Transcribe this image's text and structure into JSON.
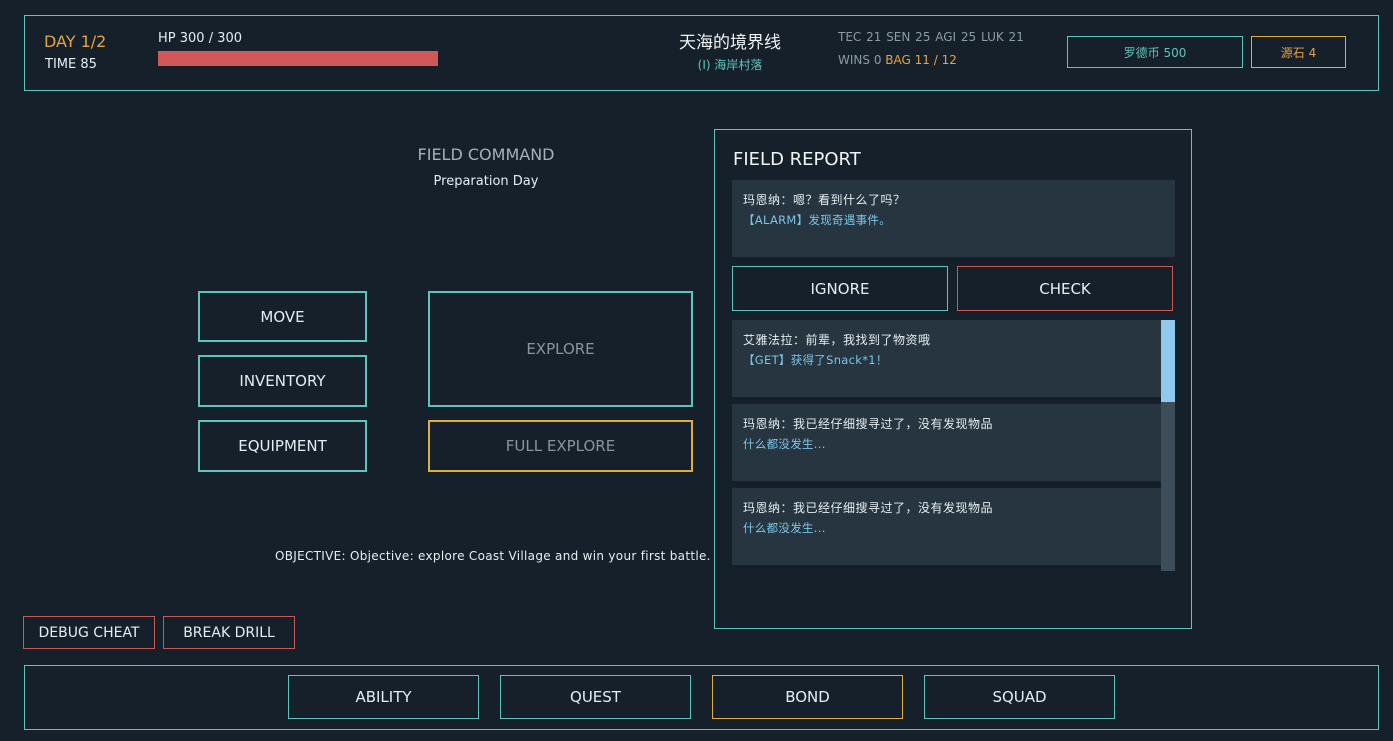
{
  "top_bar": {
    "day": "DAY 1/2",
    "time": "TIME  85",
    "hp_label": "HP  300 / 300",
    "hp_fraction": 1.0,
    "location_title": "天海的境界线",
    "location_sub": "(I)  海岸村落",
    "stats": "TEC 21  SEN 25  AGI 25  LUK 21",
    "wins": "WINS 0",
    "bag": "BAG 11 / 12",
    "coin": "罗德币  500",
    "stone": "源石  4"
  },
  "field_command": {
    "title": "FIELD COMMAND",
    "subtitle": "Preparation Day",
    "move": "MOVE",
    "inventory": "INVENTORY",
    "equipment": "EQUIPMENT",
    "explore": "EXPLORE",
    "full_explore": "FULL EXPLORE",
    "objective": "OBJECTIVE: Objective: explore Coast Village and win your first battle."
  },
  "debug": {
    "cheat": "DEBUG CHEAT",
    "break_drill": "BREAK DRILL"
  },
  "field_report": {
    "title": "FIELD REPORT",
    "alert": {
      "line1": "玛恩纳：嗯？看到什么了吗？",
      "line2": "【ALARM】发现奇遇事件。"
    },
    "ignore": "IGNORE",
    "check": "CHECK",
    "log": [
      {
        "line1": "艾雅法拉：前辈，我找到了物资哦",
        "line2": "【GET】获得了Snack*1！"
      },
      {
        "line1": "玛恩纳：我已经仔细搜寻过了，没有发现物品",
        "line2": "什么都没发生..."
      },
      {
        "line1": "玛恩纳：我已经仔细搜寻过了，没有发现物品",
        "line2": "什么都没发生..."
      }
    ]
  },
  "bottom_tabs": {
    "ability": "ABILITY",
    "quest": "QUEST",
    "bond": "BOND",
    "squad": "SQUAD"
  },
  "colors": {
    "teal": "#5fc4bb",
    "gold": "#e0ad43",
    "red": "#c85a54",
    "hp": "#d15858",
    "background": "#16202a"
  }
}
